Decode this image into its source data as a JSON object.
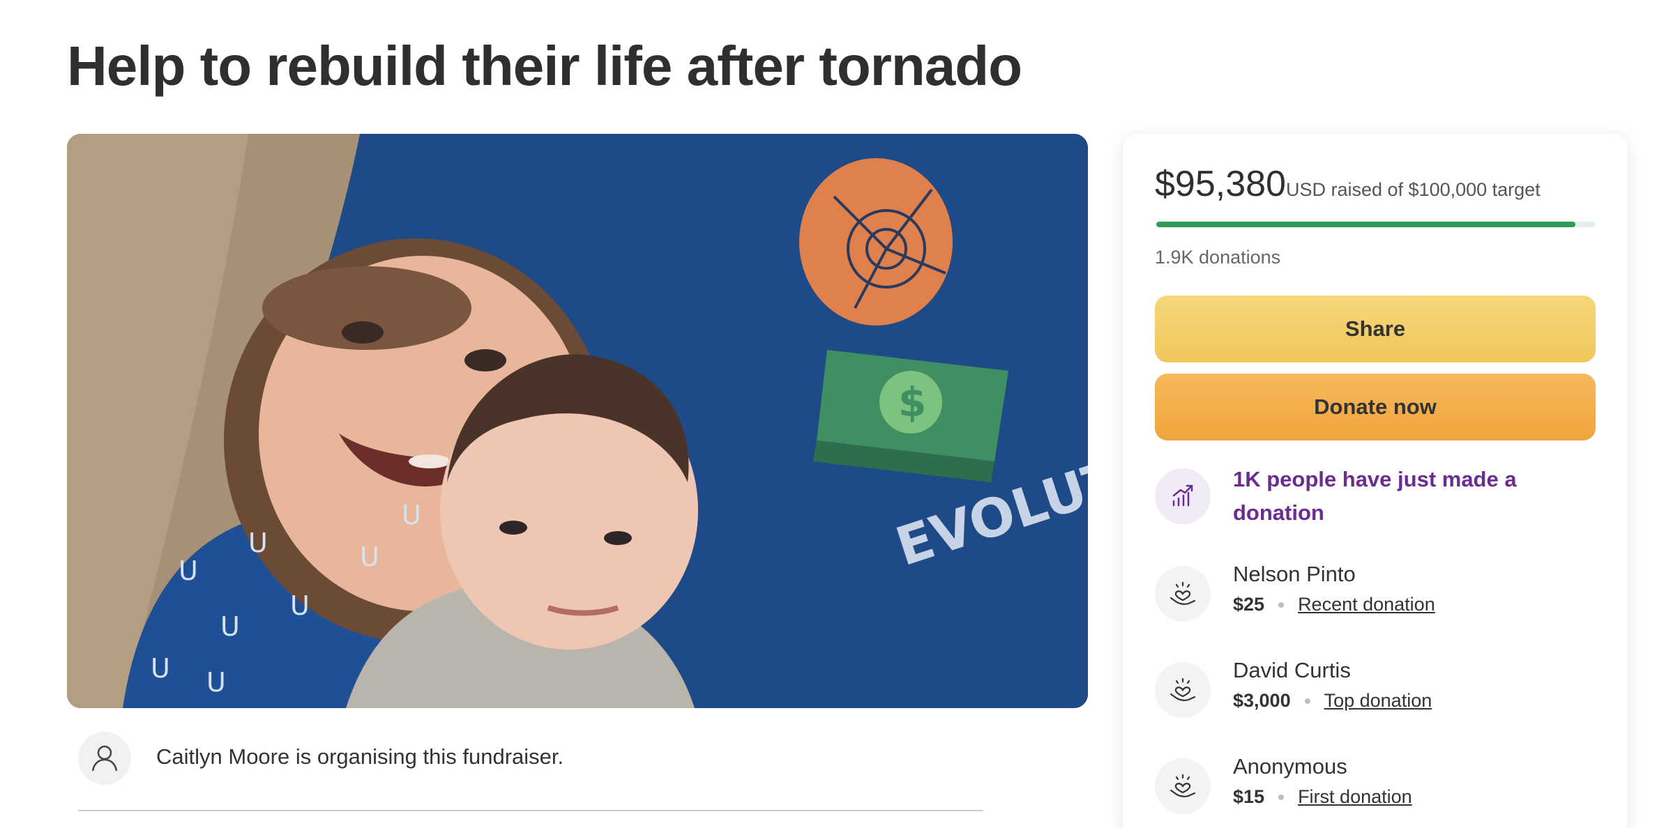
{
  "page": {
    "title": "Help to rebuild their life after tornado"
  },
  "hero": {
    "image_description": "photo-two-children",
    "shirt_text": "EVOLUT"
  },
  "organiser": {
    "text": "Caitlyn Moore is organising this fundraiser.",
    "icon": "person-icon"
  },
  "stats": {
    "raised_amount": "$95,380",
    "raised_sub": "USD raised of $100,000 target",
    "progress_fraction": 0.9538,
    "donations_count": "1.9K donations",
    "progress_color": "#2f9a55"
  },
  "actions": {
    "share_label": "Share",
    "donate_label": "Donate now",
    "share_color": "#f3cf69",
    "donate_color": "#f3ae4b"
  },
  "trend": {
    "text": "1K people have just made a donation",
    "icon": "trending-up-icon",
    "color": "#6a2c91"
  },
  "donations": [
    {
      "name": "Nelson Pinto",
      "amount": "$25",
      "tag": "Recent donation",
      "icon": "heart-hand-icon"
    },
    {
      "name": "David Curtis",
      "amount": "$3,000",
      "tag": "Top donation",
      "icon": "heart-hand-icon"
    },
    {
      "name": "Anonymous",
      "amount": "$15",
      "tag": "First donation",
      "icon": "heart-hand-icon"
    }
  ]
}
